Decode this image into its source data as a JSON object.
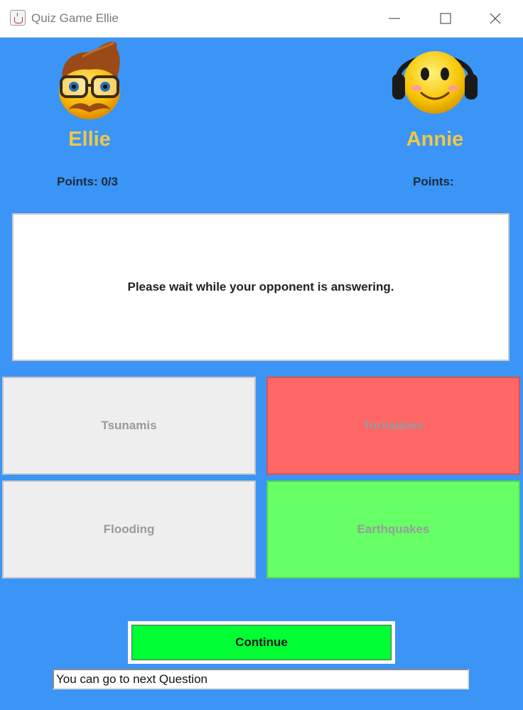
{
  "window": {
    "title": "Quiz Game Ellie",
    "app_icon": "java-cup-icon",
    "controls": [
      "minimize-icon",
      "maximize-icon",
      "close-icon"
    ]
  },
  "players": {
    "left": {
      "name": "Ellie",
      "points_label": "Points: 0/3",
      "avatar": "hipster-emoji-avatar"
    },
    "right": {
      "name": "Annie",
      "points_label": "Points:",
      "avatar": "headphones-emoji-avatar"
    }
  },
  "question": {
    "text": "Please wait while your opponent is answering."
  },
  "answers": [
    {
      "label": "Tsunamis",
      "state": "neutral",
      "color": "#eeeeee"
    },
    {
      "label": "Tornadoes",
      "state": "wrong",
      "color": "#ff6666"
    },
    {
      "label": "Flooding",
      "state": "neutral",
      "color": "#eeeeee"
    },
    {
      "label": "Earthquakes",
      "state": "correct",
      "color": "#66ff66"
    }
  ],
  "continue_button": {
    "label": "Continue",
    "color": "#00ff33"
  },
  "status": {
    "text": "You can go to next Question"
  },
  "colors": {
    "background": "#3a95f7",
    "player_name": "#f2c744"
  }
}
